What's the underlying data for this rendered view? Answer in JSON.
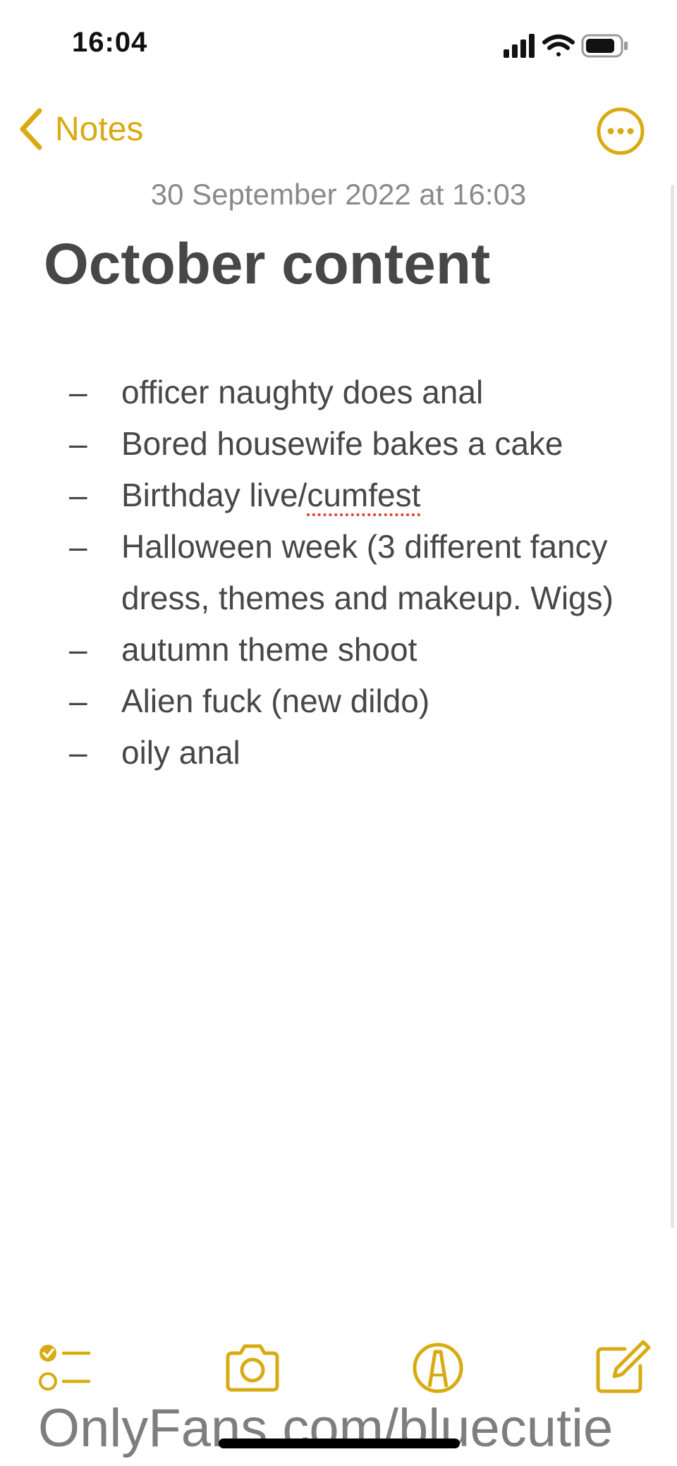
{
  "status_bar": {
    "time": "16:04",
    "icons": [
      "cellular-signal-icon",
      "wifi-icon",
      "battery-icon"
    ]
  },
  "nav": {
    "back_label": "Notes",
    "back_icon": "chevron-left-icon",
    "more_icon": "ellipsis-circle-icon",
    "accent_color": "#d9ab12"
  },
  "note": {
    "date": "30 September 2022 at 16:03",
    "title": "October content",
    "bullet": "–",
    "items": [
      "officer naughty does anal",
      "Bored housewife bakes a cake",
      {
        "before": "Birthday live/",
        "misspelled": "cumfest"
      },
      "Halloween week (3 different fancy dress, themes and makeup. Wigs)",
      "autumn theme shoot",
      "Alien fuck (new dildo)",
      "oily anal"
    ]
  },
  "toolbar": {
    "icons": [
      "checklist-icon",
      "camera-icon",
      "markup-pen-icon",
      "compose-icon"
    ]
  },
  "watermark": "OnlyFans.com/bluecutie"
}
